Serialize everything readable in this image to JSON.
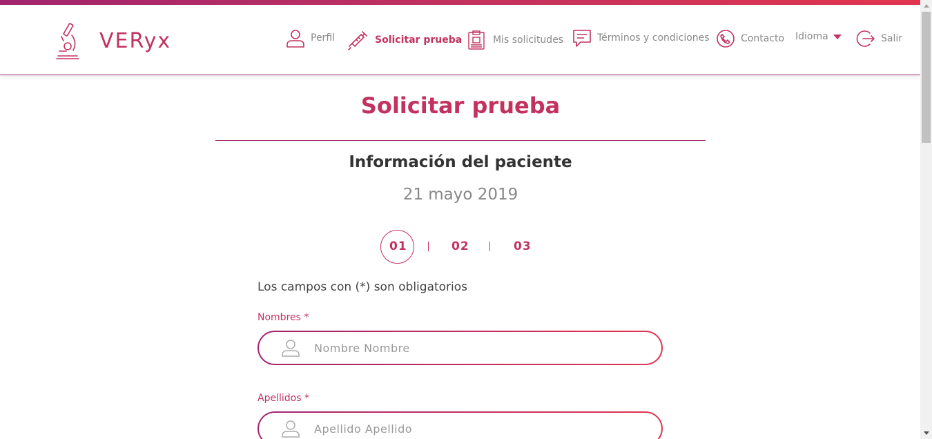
{
  "brand": {
    "name": "VERyx",
    "accent": "#c2325f",
    "accent_dark": "#a1246e",
    "accent_light": "#e1354e"
  },
  "nav": {
    "profile": "Perfil",
    "request_test": "Solicitar prueba",
    "my_requests": "Mis solicitudes",
    "terms": "Términos y condiciones",
    "contact": "Contacto",
    "language": "Idioma",
    "logout": "Salir"
  },
  "page": {
    "title": "Solicitar prueba",
    "section_title": "Información del paciente",
    "date": "21 mayo 2019"
  },
  "steps": [
    "01",
    "02",
    "03"
  ],
  "active_step": 1,
  "form": {
    "required_note": "Los campos con (*) son obligatorios",
    "first_name": {
      "label": "Nombres *",
      "placeholder": "Nombre Nombre",
      "value": ""
    },
    "last_name": {
      "label": "Apellidos *",
      "placeholder": "Apellido Apellido",
      "value": ""
    }
  },
  "icons": {
    "logo": "microscope-icon",
    "profile": "user-icon",
    "request_test": "syringe-icon",
    "my_requests": "clipboard-icon",
    "terms": "message-icon",
    "contact": "phone-icon",
    "language": "caret-down-icon",
    "logout": "logout-icon",
    "field": "user-icon"
  }
}
